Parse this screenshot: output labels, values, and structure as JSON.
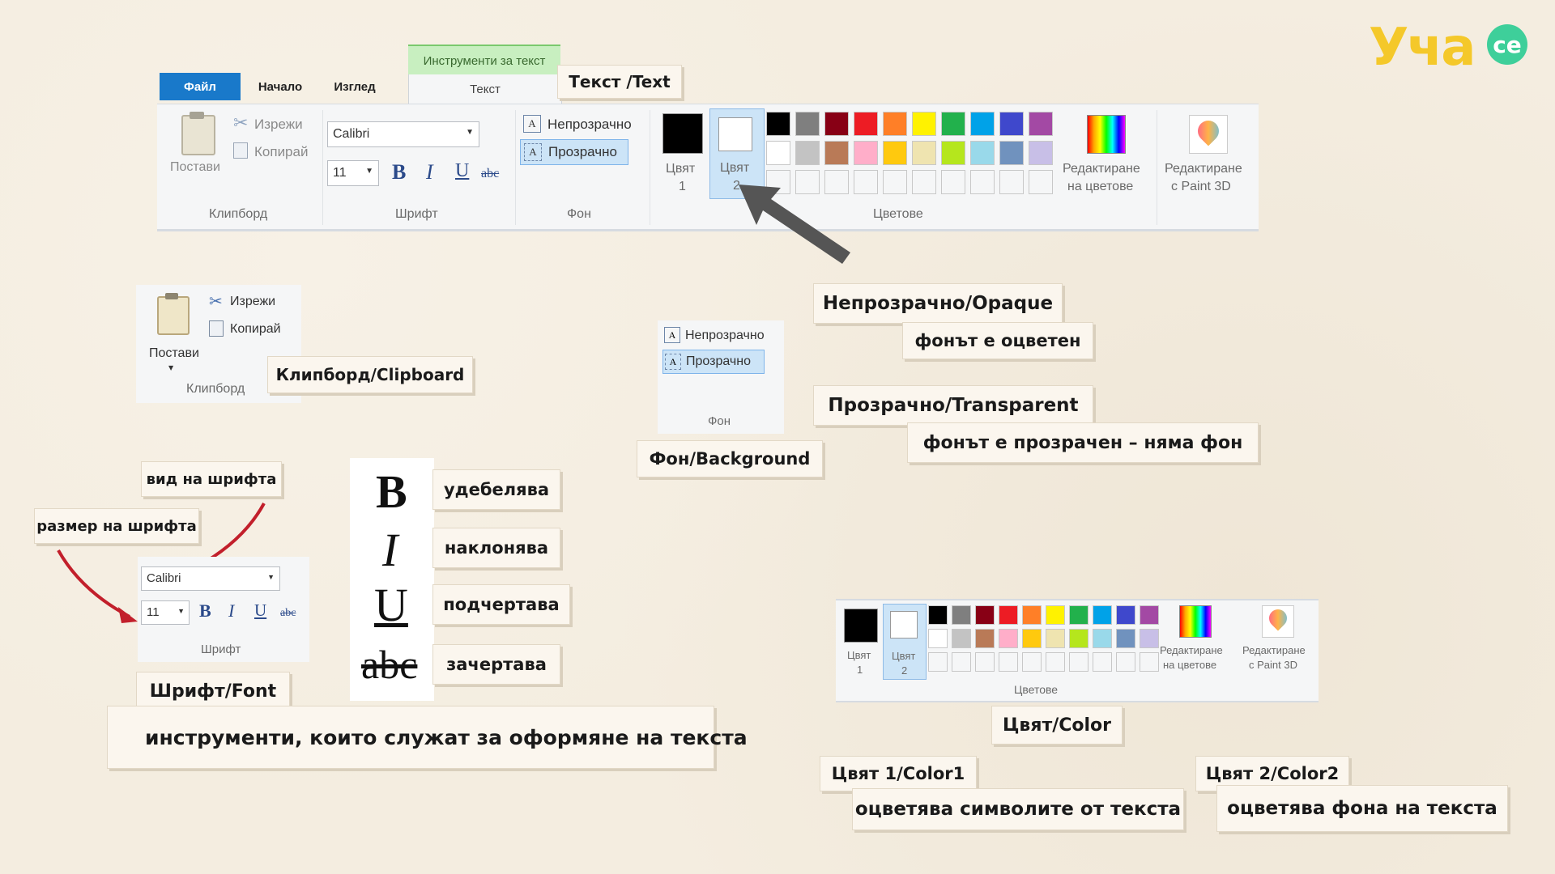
{
  "logo": {
    "text": "Уча",
    "badge": "се"
  },
  "ribbon": {
    "context_tab": "Инструменти за текст",
    "tabs": [
      "Файл",
      "Начало",
      "Изглед",
      "Текст"
    ],
    "clipboard": {
      "paste": "Постави",
      "cut": "Изрежи",
      "copy": "Копирай",
      "group": "Клипборд"
    },
    "font": {
      "family": "Calibri",
      "size": "11",
      "bold": "B",
      "italic": "I",
      "underline": "U",
      "strike": "abc",
      "group": "Шрифт"
    },
    "background": {
      "opaque": "Непрозрачно",
      "transparent": "Прозрачно",
      "group": "Фон"
    },
    "colors": {
      "color1": "Цвят",
      "color1_num": "1",
      "color2": "Цвят",
      "color2_num": "2",
      "edit": "Редактиране",
      "edit2": "на цветове",
      "paint3d": "Редактиране",
      "paint3d2": "с Paint 3D",
      "group": "Цветове",
      "palette_row1": [
        "#000000",
        "#7f7f7f",
        "#880015",
        "#ed1c24",
        "#ff7f27",
        "#fff200",
        "#22b14c",
        "#00a2e8",
        "#3f48cc",
        "#a349a4"
      ],
      "palette_row2": [
        "#ffffff",
        "#c3c3c3",
        "#b97a57",
        "#ffaec9",
        "#ffc90e",
        "#efe4b0",
        "#b5e61d",
        "#99d9ea",
        "#7092be",
        "#c8bfe7"
      ]
    }
  },
  "labels": {
    "text_tab": "Текст /Text",
    "opaque": "Непрозрачно/Opaque",
    "opaque_desc": "фонът е оцветен",
    "transparent": "Прозрачно/Transparent",
    "transparent_desc": "фонът е прозрачен – няма фон",
    "clipboard": "Клипборд/Clipboard",
    "background": "Фон/Background",
    "font_type": "вид на шрифта",
    "font_size": "размер на шрифта",
    "bold": "удебелява",
    "italic": "наклонява",
    "underline": "подчертава",
    "strike": "зачертава",
    "font": "Шрифт/Font",
    "font_desc": "инструменти, които служат за оформяне на текста",
    "color": "Цвят/Color",
    "color1": "Цвят 1/Color1",
    "color1_desc": "оцветява символите от текста",
    "color2": "Цвят 2/Color2",
    "color2_desc": "оцветява фона на текста"
  },
  "big_letters": {
    "bold": "B",
    "italic": "I",
    "underline": "U",
    "strike": "abc"
  }
}
